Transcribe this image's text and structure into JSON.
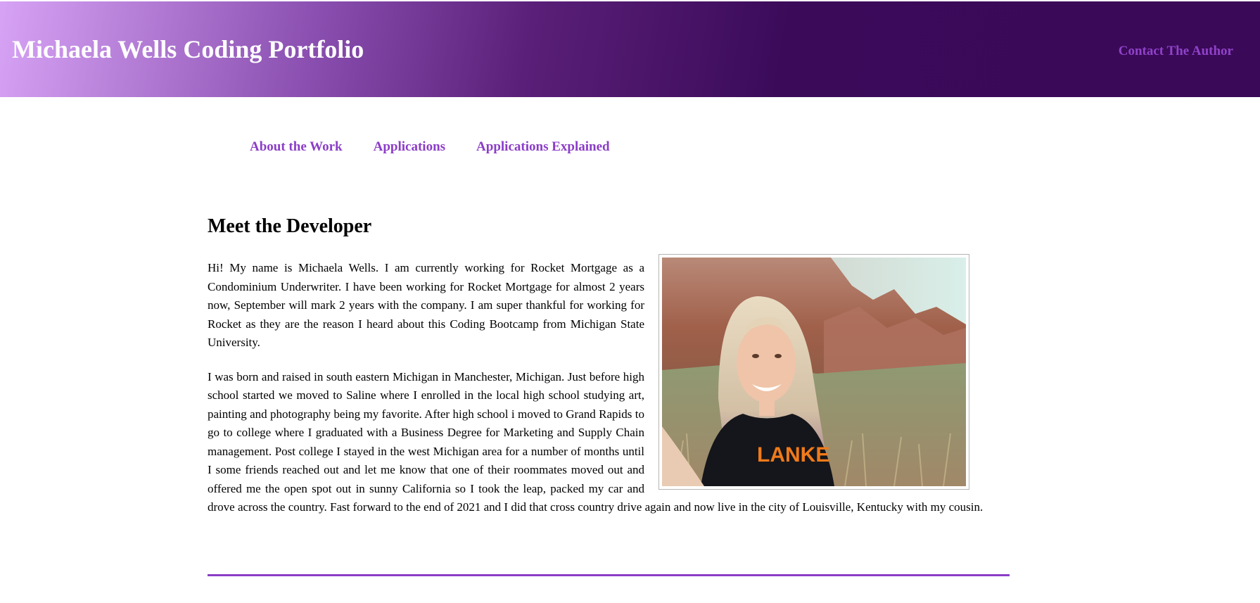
{
  "header": {
    "site_title": "Michaela Wells Coding Portfolio",
    "contact_label": "Contact The Author"
  },
  "nav": {
    "items": [
      {
        "label": "About the Work"
      },
      {
        "label": "Applications"
      },
      {
        "label": "Applications Explained"
      }
    ]
  },
  "main": {
    "heading": "Meet the Developer",
    "paragraphs": [
      "Hi! My name is Michaela Wells. I am currently working for Rocket Mortgage as a Condominium Underwriter. I have been working for Rocket Mortgage for almost 2 years now, September will mark 2 years with the company. I am super thankful for working for Rocket as they are the reason I heard about this Coding Bootcamp from Michigan State University.",
      "I was born and raised in south eastern Michigan in Manchester, Michigan. Just before high school started we moved to Saline where I enrolled in the local high school studying art, painting and photography being my favorite. After high school i moved to Grand Rapids to go to college where I graduated with a Business Degree for Marketing and Supply Chain management. Post college I stayed in the west Michigan area for a number of months until I some friends reached out and let me know that one of their roommates moved out and offered me the open spot out in sunny California so I took the leap, packed my car and drove across the country. Fast forward to the end of 2021 and I did that cross country drive again and now live in the city of Louisville, Kentucky with my cousin."
    ],
    "photo_shirt_text": "LANKE"
  },
  "colors": {
    "header_dark": "#3a0958",
    "header_light": "#d7a3f5",
    "link_purple": "#8b3dc7",
    "divider": "#8b3dc7"
  }
}
